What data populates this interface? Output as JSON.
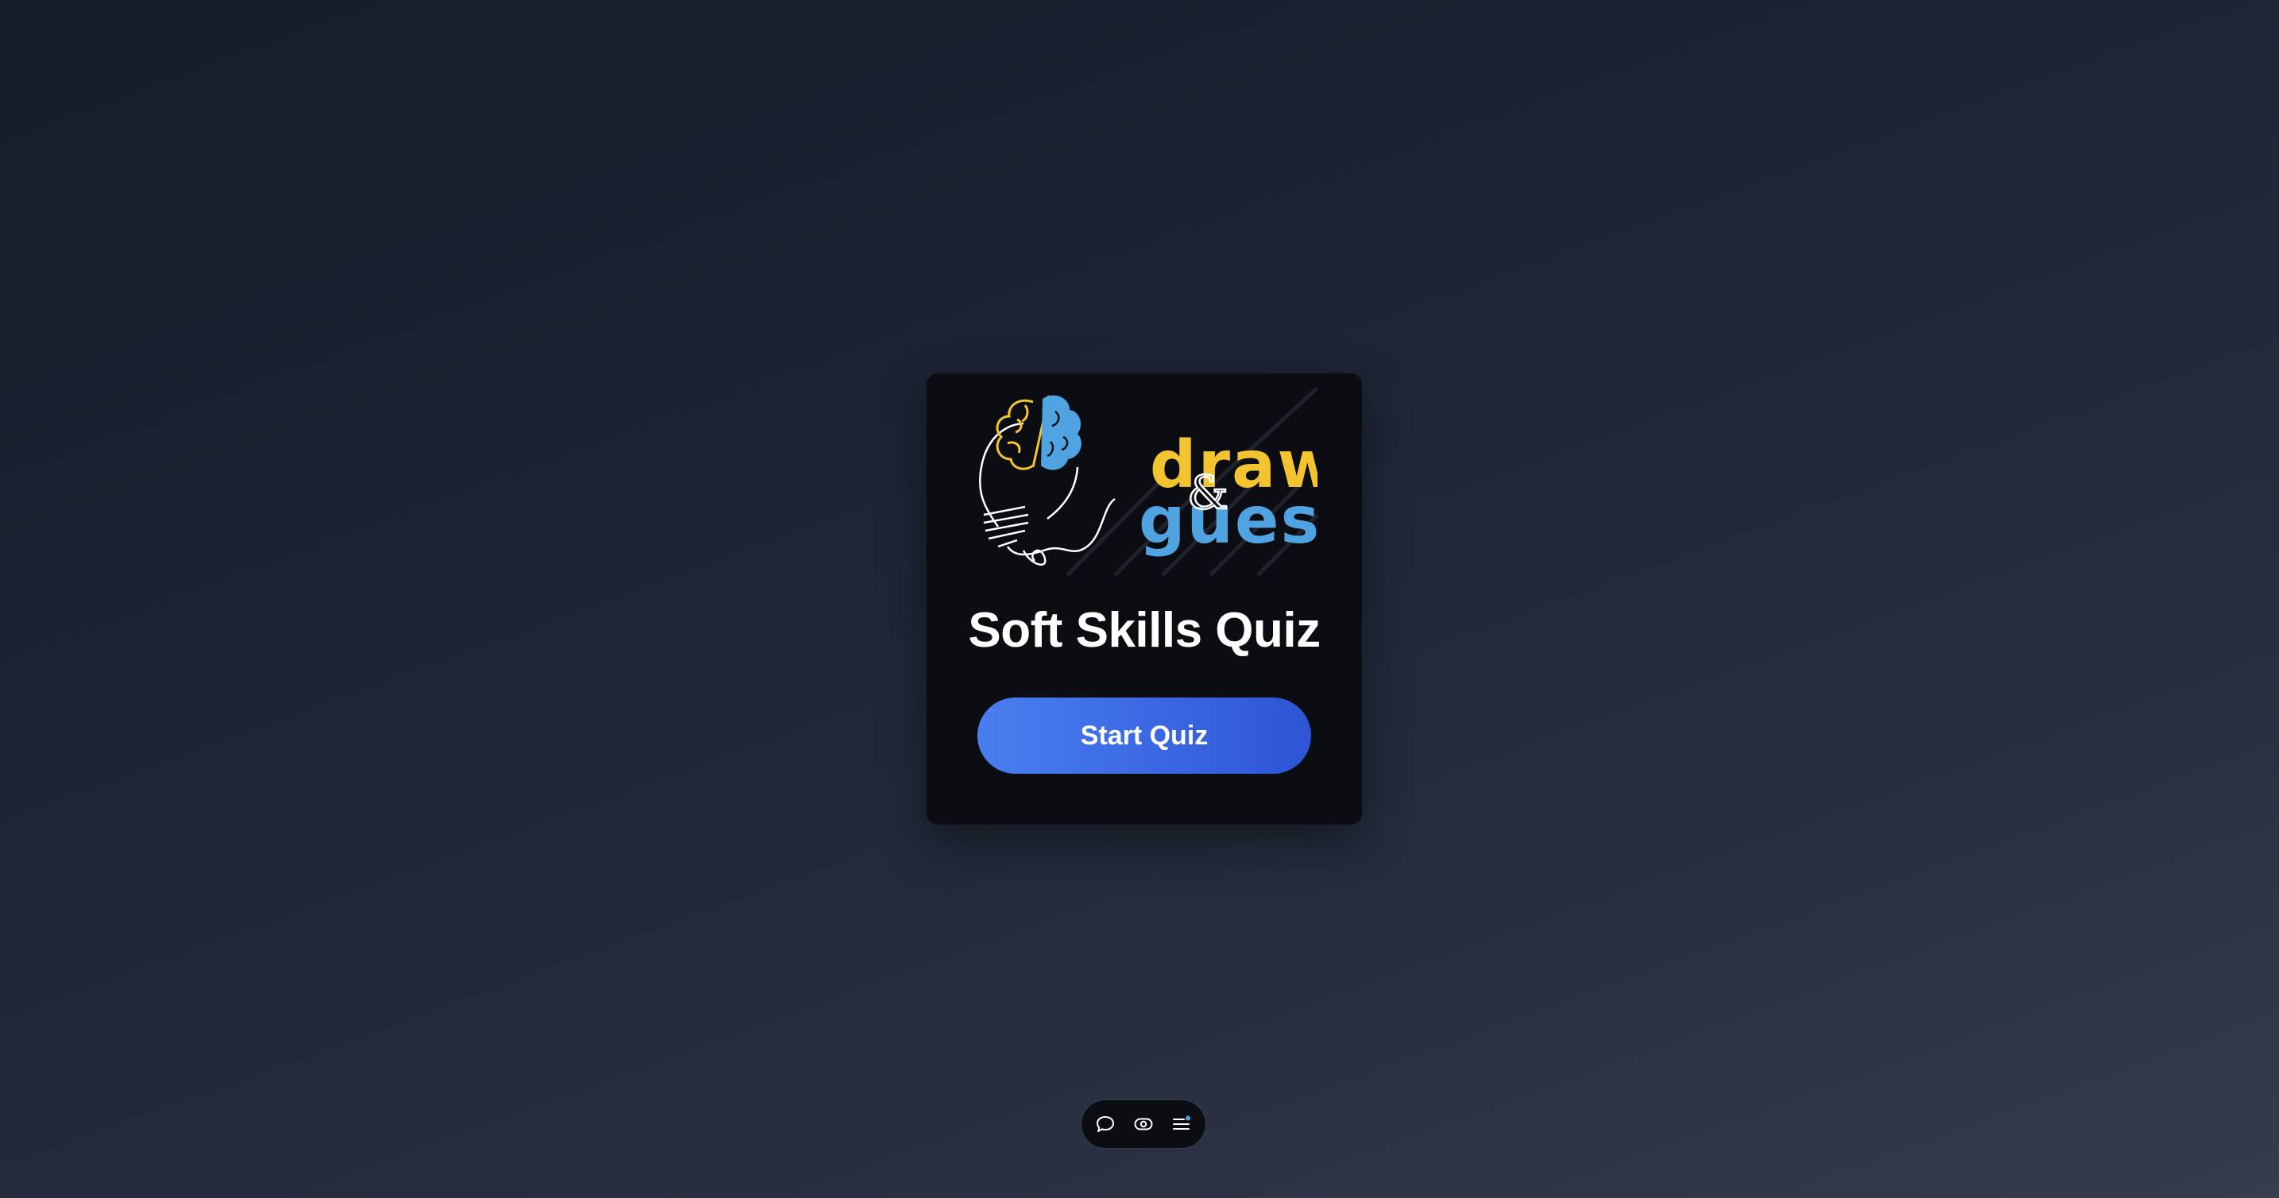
{
  "logo": {
    "word1": "draw",
    "ampersand": "&",
    "word2": "guess",
    "colors": {
      "yellow": "#f4c430",
      "blue": "#4fa3e0"
    }
  },
  "card": {
    "title": "Soft Skills Quiz",
    "start_button_label": "Start Quiz"
  },
  "toolbar": {
    "items": [
      {
        "icon": "chat-bubble-icon"
      },
      {
        "icon": "eye-toggle-icon"
      },
      {
        "icon": "menu-list-icon",
        "badge": true
      }
    ]
  },
  "colors": {
    "accent_start": "#4a7ef0",
    "accent_end": "#2d55d6",
    "badge": "#4fa3e0"
  }
}
